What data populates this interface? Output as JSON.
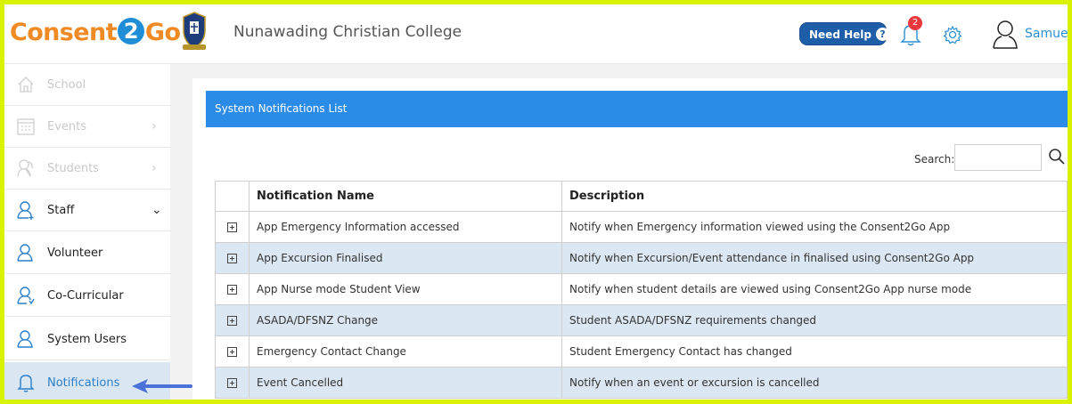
{
  "header": {
    "logo_part1": "Consent",
    "logo_part2": "2",
    "logo_part3": "Go",
    "school_name": "Nunawading Christian College",
    "help_label": "Need Help",
    "help_icon": "?",
    "notification_count": "2",
    "user_name": "Samue"
  },
  "sidebar": {
    "items": [
      {
        "label": "School",
        "icon": "home-icon"
      },
      {
        "label": "Events",
        "icon": "calendar-icon"
      },
      {
        "label": "Students",
        "icon": "students-icon"
      },
      {
        "label": "Staff",
        "icon": "staff-icon"
      },
      {
        "label": "Volunteer",
        "icon": "volunteer-icon"
      },
      {
        "label": "Co-Curricular",
        "icon": "co-curricular-icon"
      },
      {
        "label": "System Users",
        "icon": "system-users-icon"
      },
      {
        "label": "Notifications",
        "icon": "bell-icon"
      }
    ],
    "active": "Notifications"
  },
  "panel": {
    "title": "System Notifications List",
    "search_label": "Search:",
    "search_value": ""
  },
  "table": {
    "columns": [
      "",
      "Notification Name",
      "Description"
    ],
    "rows": [
      {
        "name": "App Emergency Information accessed",
        "description": "Notify when Emergency information viewed using the Consent2Go App"
      },
      {
        "name": "App Excursion Finalised",
        "description": "Notify when Excursion/Event attendance in finalised using Consent2Go App"
      },
      {
        "name": "App Nurse mode Student View",
        "description": "Notify when student details are viewed using Consent2Go App nurse mode"
      },
      {
        "name": "ASADA/DFSNZ Change",
        "description": "Student ASADA/DFSNZ requirements changed"
      },
      {
        "name": "Emergency Contact Change",
        "description": "Student Emergency Contact has changed"
      },
      {
        "name": "Event Cancelled",
        "description": "Notify when an event or excursion is cancelled"
      }
    ]
  },
  "colors": {
    "accent": "#2b8ce8",
    "highlight_border": "#d9f200",
    "active_bg": "#dbe6f3",
    "badge": "#e8383d",
    "logo_orange": "#f08a24",
    "logo_blue": "#1f8ed6"
  }
}
